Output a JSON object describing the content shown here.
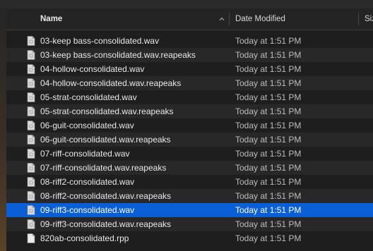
{
  "header": {
    "name_label": "Name",
    "date_label": "Date Modified",
    "size_label": "Siz"
  },
  "icons": {
    "sort": "chevron-up-icon",
    "file": "document-icon"
  },
  "colors": {
    "selection": "#0a5fd6",
    "background": "#1e1e1e"
  },
  "files": [
    {
      "name": "03-keep bass-consolidated.wav",
      "date": "Today at 1:51 PM",
      "type": "wav"
    },
    {
      "name": "03-keep bass-consolidated.wav.reapeaks",
      "date": "Today at 1:51 PM",
      "type": "reapeaks"
    },
    {
      "name": "04-hollow-consolidated.wav",
      "date": "Today at 1:51 PM",
      "type": "wav"
    },
    {
      "name": "04-hollow-consolidated.wav.reapeaks",
      "date": "Today at 1:51 PM",
      "type": "reapeaks"
    },
    {
      "name": "05-strat-consolidated.wav",
      "date": "Today at 1:51 PM",
      "type": "wav"
    },
    {
      "name": "05-strat-consolidated.wav.reapeaks",
      "date": "Today at 1:51 PM",
      "type": "reapeaks"
    },
    {
      "name": "06-guit-consolidated.wav",
      "date": "Today at 1:51 PM",
      "type": "wav"
    },
    {
      "name": "06-guit-consolidated.wav.reapeaks",
      "date": "Today at 1:51 PM",
      "type": "reapeaks"
    },
    {
      "name": "07-riff-consolidated.wav",
      "date": "Today at 1:51 PM",
      "type": "wav"
    },
    {
      "name": "07-riff-consolidated.wav.reapeaks",
      "date": "Today at 1:51 PM",
      "type": "reapeaks"
    },
    {
      "name": "08-riff2-consolidated.wav",
      "date": "Today at 1:51 PM",
      "type": "wav"
    },
    {
      "name": "08-riff2-consolidated.wav.reapeaks",
      "date": "Today at 1:51 PM",
      "type": "reapeaks"
    },
    {
      "name": "09-riff3-consolidated.wav",
      "date": "Today at 1:51 PM",
      "type": "wav",
      "selected": true
    },
    {
      "name": "09-riff3-consolidated.wav.reapeaks",
      "date": "Today at 1:51 PM",
      "type": "reapeaks"
    },
    {
      "name": "820ab-consolidated.rpp",
      "date": "Today at 1:51 PM",
      "type": "rpp"
    }
  ]
}
